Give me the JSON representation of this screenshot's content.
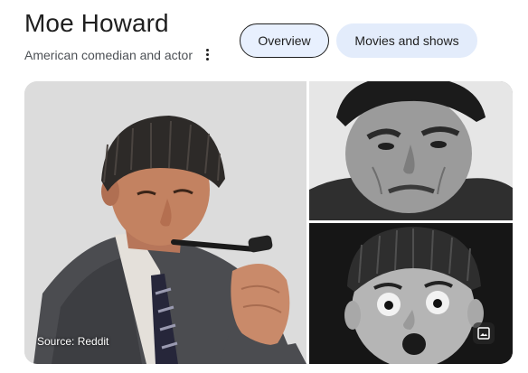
{
  "person": {
    "name": "Moe Howard",
    "description": "American comedian and actor"
  },
  "tabs": [
    {
      "label": "Overview",
      "selected": true
    },
    {
      "label": "Movies and shows",
      "selected": false
    }
  ],
  "gallery": {
    "main_source": "Source: Reddit"
  },
  "icons": {
    "more": "more-vert-icon",
    "image": "image-icon"
  },
  "colors": {
    "chip_selected": "#e8f0fe",
    "chip_default": "#e3ecfb",
    "text_primary": "#1f1f1f",
    "text_secondary": "#4d5156"
  }
}
